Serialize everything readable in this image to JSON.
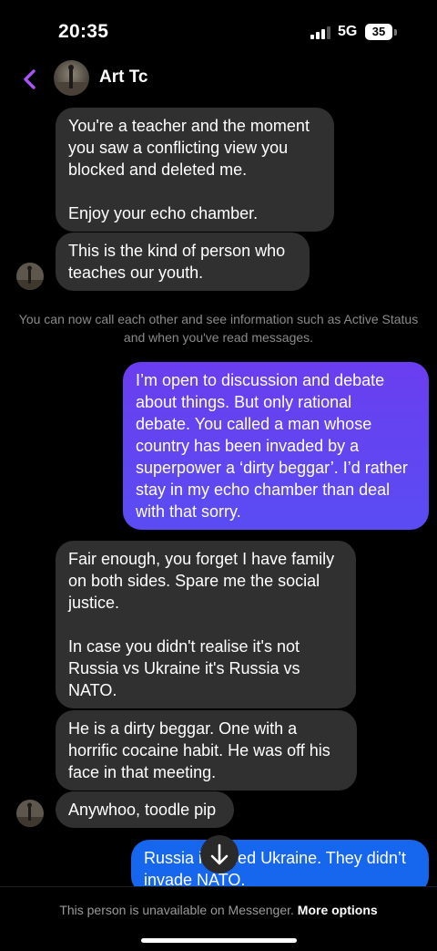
{
  "status_bar": {
    "time": "20:35",
    "network": "5G",
    "battery": "35"
  },
  "header": {
    "contact_name": "Art Tc"
  },
  "messages": [
    {
      "direction": "incoming",
      "text": "You're a teacher and the moment\nyou saw a conflicting view you\nblocked and deleted me.\n\nEnjoy your echo chamber."
    },
    {
      "direction": "incoming",
      "text": "This is the kind of person who\nteaches our youth."
    },
    {
      "direction": "outgoing",
      "text": "I’m open to discussion and debate\nabout things. But only rational\ndebate. You called a man whose\ncountry has been invaded by a\nsuperpower a ‘dirty beggar’. I’d rather\nstay in my echo chamber than deal\nwith that sorry."
    },
    {
      "direction": "incoming",
      "text": "Fair enough, you forget I have family\non both sides. Spare me the social\njustice.\n\nIn case you didn't realise it's not\nRussia vs Ukraine it's Russia vs\nNATO."
    },
    {
      "direction": "incoming",
      "text": "He is a dirty beggar. One with a\nhorrific cocaine habit. He was off his\nface in that meeting."
    },
    {
      "direction": "incoming",
      "text": "Anywhoo, toodle pip"
    },
    {
      "direction": "outgoing",
      "text": "Russia invaded Ukraine. They didn’t\ninvade NATO."
    }
  ],
  "system_note": "You can now call each other and see information such as Active Status and when you've read messages.",
  "footer": {
    "text": "This person is unavailable on Messenger.",
    "link": "More options"
  },
  "colors": {
    "accent": "#a855f7",
    "incoming_bubble": "#303030",
    "outgoing_top": "#6a3ef0",
    "outgoing_bottom": "#1766ee"
  },
  "icons": {
    "back": "chevron-left-icon",
    "scroll": "arrow-down-icon"
  }
}
